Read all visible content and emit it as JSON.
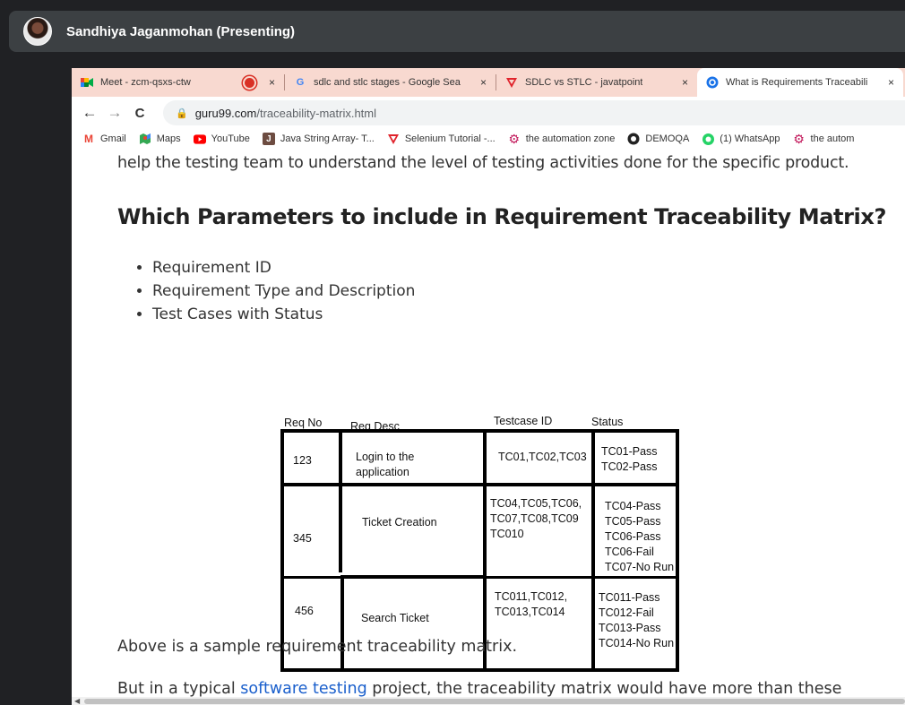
{
  "meet": {
    "presenter": "Sandhiya Jaganmohan (Presenting)"
  },
  "tabs": [
    {
      "title": "Meet - zcm-qsxs-ctw",
      "icon": "google-meet-icon",
      "close": "×"
    },
    {
      "title": "sdlc and stlc stages - Google Sea",
      "icon": "google-icon",
      "close": "×"
    },
    {
      "title": "SDLC vs STLC - javatpoint",
      "icon": "javatpoint-icon",
      "close": "×"
    },
    {
      "title": "What is Requirements Traceabili",
      "icon": "guru99-icon",
      "close": "×"
    }
  ],
  "toolbar": {
    "back": "←",
    "forward": "→",
    "reload": "C",
    "url_host": "guru99.com",
    "url_path": "/traceability-matrix.html"
  },
  "bookmarks": [
    {
      "label": "Gmail",
      "icon": "gmail-icon"
    },
    {
      "label": "Maps",
      "icon": "maps-icon"
    },
    {
      "label": "YouTube",
      "icon": "youtube-icon"
    },
    {
      "label": "Java String Array- T...",
      "icon": "java-icon"
    },
    {
      "label": "Selenium Tutorial -...",
      "icon": "selenium-icon"
    },
    {
      "label": "the automation zone",
      "icon": "gear-icon"
    },
    {
      "label": "DEMOQA",
      "icon": "demoqa-icon"
    },
    {
      "label": "(1) WhatsApp",
      "icon": "whatsapp-icon"
    },
    {
      "label": "the autom",
      "icon": "gear-icon"
    }
  ],
  "article": {
    "para_top": "help the testing team to understand the level of testing activities done for the specific product.",
    "heading": "Which Parameters to include in Requirement Traceability Matrix?",
    "bullets": [
      "Requirement ID",
      "Requirement Type and Description",
      "Test Cases with Status"
    ],
    "para_bottom": "Above is a sample requirement traceability matrix.",
    "para_last_pre": "But in a typical ",
    "para_last_link": "software testing",
    "para_last_post": " project, the traceability matrix would have more than these"
  },
  "matrix": {
    "headers": [
      "Req No",
      "Req Desc",
      "Testcase ID",
      "Status"
    ],
    "rows": [
      {
        "req_no": "123",
        "desc": "Login to the\napplication",
        "testcases": "TC01,TC02,TC03",
        "status": "TC01-Pass\nTC02-Pass"
      },
      {
        "req_no": "345",
        "desc": "Ticket Creation",
        "testcases": "TC04,TC05,TC06,\nTC07,TC08,TC09\nTC010",
        "status": "TC04-Pass\nTC05-Pass\nTC06-Pass\nTC06-Fail\nTC07-No Run"
      },
      {
        "req_no": "456",
        "desc": "Search Ticket",
        "testcases": "TC011,TC012,\nTC013,TC014",
        "status": "TC011-Pass\nTC012-Fail\nTC013-Pass\nTC014-No Run"
      }
    ]
  }
}
